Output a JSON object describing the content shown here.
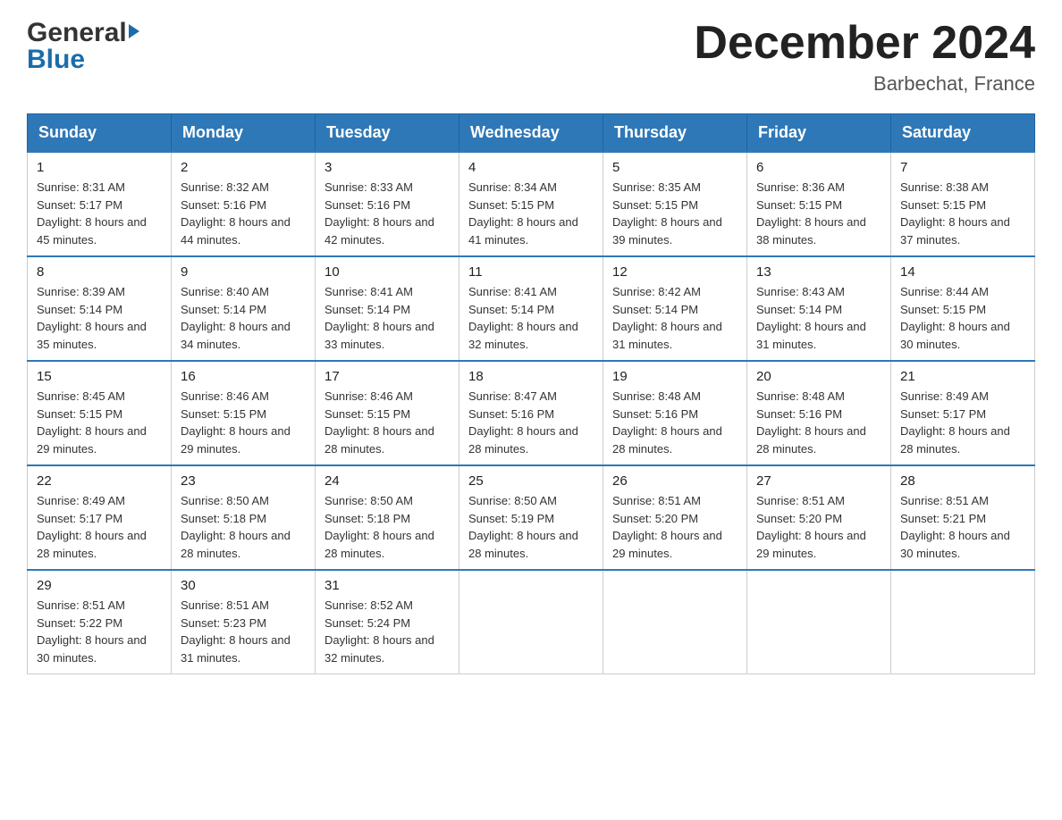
{
  "header": {
    "logo": {
      "general_text": "General",
      "blue_text": "Blue"
    },
    "title": "December 2024",
    "location": "Barbechat, France"
  },
  "calendar": {
    "days_of_week": [
      "Sunday",
      "Monday",
      "Tuesday",
      "Wednesday",
      "Thursday",
      "Friday",
      "Saturday"
    ],
    "weeks": [
      [
        {
          "day": "1",
          "sunrise": "Sunrise: 8:31 AM",
          "sunset": "Sunset: 5:17 PM",
          "daylight": "Daylight: 8 hours and 45 minutes."
        },
        {
          "day": "2",
          "sunrise": "Sunrise: 8:32 AM",
          "sunset": "Sunset: 5:16 PM",
          "daylight": "Daylight: 8 hours and 44 minutes."
        },
        {
          "day": "3",
          "sunrise": "Sunrise: 8:33 AM",
          "sunset": "Sunset: 5:16 PM",
          "daylight": "Daylight: 8 hours and 42 minutes."
        },
        {
          "day": "4",
          "sunrise": "Sunrise: 8:34 AM",
          "sunset": "Sunset: 5:15 PM",
          "daylight": "Daylight: 8 hours and 41 minutes."
        },
        {
          "day": "5",
          "sunrise": "Sunrise: 8:35 AM",
          "sunset": "Sunset: 5:15 PM",
          "daylight": "Daylight: 8 hours and 39 minutes."
        },
        {
          "day": "6",
          "sunrise": "Sunrise: 8:36 AM",
          "sunset": "Sunset: 5:15 PM",
          "daylight": "Daylight: 8 hours and 38 minutes."
        },
        {
          "day": "7",
          "sunrise": "Sunrise: 8:38 AM",
          "sunset": "Sunset: 5:15 PM",
          "daylight": "Daylight: 8 hours and 37 minutes."
        }
      ],
      [
        {
          "day": "8",
          "sunrise": "Sunrise: 8:39 AM",
          "sunset": "Sunset: 5:14 PM",
          "daylight": "Daylight: 8 hours and 35 minutes."
        },
        {
          "day": "9",
          "sunrise": "Sunrise: 8:40 AM",
          "sunset": "Sunset: 5:14 PM",
          "daylight": "Daylight: 8 hours and 34 minutes."
        },
        {
          "day": "10",
          "sunrise": "Sunrise: 8:41 AM",
          "sunset": "Sunset: 5:14 PM",
          "daylight": "Daylight: 8 hours and 33 minutes."
        },
        {
          "day": "11",
          "sunrise": "Sunrise: 8:41 AM",
          "sunset": "Sunset: 5:14 PM",
          "daylight": "Daylight: 8 hours and 32 minutes."
        },
        {
          "day": "12",
          "sunrise": "Sunrise: 8:42 AM",
          "sunset": "Sunset: 5:14 PM",
          "daylight": "Daylight: 8 hours and 31 minutes."
        },
        {
          "day": "13",
          "sunrise": "Sunrise: 8:43 AM",
          "sunset": "Sunset: 5:14 PM",
          "daylight": "Daylight: 8 hours and 31 minutes."
        },
        {
          "day": "14",
          "sunrise": "Sunrise: 8:44 AM",
          "sunset": "Sunset: 5:15 PM",
          "daylight": "Daylight: 8 hours and 30 minutes."
        }
      ],
      [
        {
          "day": "15",
          "sunrise": "Sunrise: 8:45 AM",
          "sunset": "Sunset: 5:15 PM",
          "daylight": "Daylight: 8 hours and 29 minutes."
        },
        {
          "day": "16",
          "sunrise": "Sunrise: 8:46 AM",
          "sunset": "Sunset: 5:15 PM",
          "daylight": "Daylight: 8 hours and 29 minutes."
        },
        {
          "day": "17",
          "sunrise": "Sunrise: 8:46 AM",
          "sunset": "Sunset: 5:15 PM",
          "daylight": "Daylight: 8 hours and 28 minutes."
        },
        {
          "day": "18",
          "sunrise": "Sunrise: 8:47 AM",
          "sunset": "Sunset: 5:16 PM",
          "daylight": "Daylight: 8 hours and 28 minutes."
        },
        {
          "day": "19",
          "sunrise": "Sunrise: 8:48 AM",
          "sunset": "Sunset: 5:16 PM",
          "daylight": "Daylight: 8 hours and 28 minutes."
        },
        {
          "day": "20",
          "sunrise": "Sunrise: 8:48 AM",
          "sunset": "Sunset: 5:16 PM",
          "daylight": "Daylight: 8 hours and 28 minutes."
        },
        {
          "day": "21",
          "sunrise": "Sunrise: 8:49 AM",
          "sunset": "Sunset: 5:17 PM",
          "daylight": "Daylight: 8 hours and 28 minutes."
        }
      ],
      [
        {
          "day": "22",
          "sunrise": "Sunrise: 8:49 AM",
          "sunset": "Sunset: 5:17 PM",
          "daylight": "Daylight: 8 hours and 28 minutes."
        },
        {
          "day": "23",
          "sunrise": "Sunrise: 8:50 AM",
          "sunset": "Sunset: 5:18 PM",
          "daylight": "Daylight: 8 hours and 28 minutes."
        },
        {
          "day": "24",
          "sunrise": "Sunrise: 8:50 AM",
          "sunset": "Sunset: 5:18 PM",
          "daylight": "Daylight: 8 hours and 28 minutes."
        },
        {
          "day": "25",
          "sunrise": "Sunrise: 8:50 AM",
          "sunset": "Sunset: 5:19 PM",
          "daylight": "Daylight: 8 hours and 28 minutes."
        },
        {
          "day": "26",
          "sunrise": "Sunrise: 8:51 AM",
          "sunset": "Sunset: 5:20 PM",
          "daylight": "Daylight: 8 hours and 29 minutes."
        },
        {
          "day": "27",
          "sunrise": "Sunrise: 8:51 AM",
          "sunset": "Sunset: 5:20 PM",
          "daylight": "Daylight: 8 hours and 29 minutes."
        },
        {
          "day": "28",
          "sunrise": "Sunrise: 8:51 AM",
          "sunset": "Sunset: 5:21 PM",
          "daylight": "Daylight: 8 hours and 30 minutes."
        }
      ],
      [
        {
          "day": "29",
          "sunrise": "Sunrise: 8:51 AM",
          "sunset": "Sunset: 5:22 PM",
          "daylight": "Daylight: 8 hours and 30 minutes."
        },
        {
          "day": "30",
          "sunrise": "Sunrise: 8:51 AM",
          "sunset": "Sunset: 5:23 PM",
          "daylight": "Daylight: 8 hours and 31 minutes."
        },
        {
          "day": "31",
          "sunrise": "Sunrise: 8:52 AM",
          "sunset": "Sunset: 5:24 PM",
          "daylight": "Daylight: 8 hours and 32 minutes."
        },
        null,
        null,
        null,
        null
      ]
    ]
  }
}
